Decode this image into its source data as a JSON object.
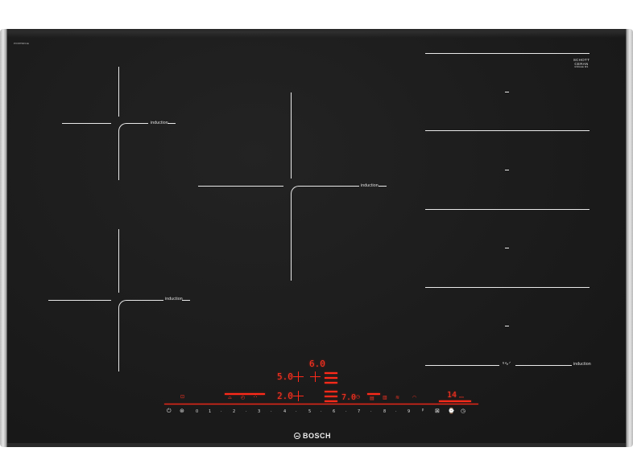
{
  "hob": {
    "model_code": "PXV875DV1E",
    "brand": "BOSCH",
    "glass_brand_line1": "SCHOTT",
    "glass_brand_line2": "CERAN",
    "glass_brand_line3": "MIRAGE MS",
    "zones": {
      "front_left_label": "induction",
      "rear_left_label": "induction",
      "center_label": "induction",
      "flex_label": "induction",
      "flex_link_icon": "link-wave-icon"
    }
  },
  "display": {
    "top_value": "6.0",
    "left_value": "5.0",
    "mid_value": "2.0",
    "right_value": "7.0",
    "timer_value": "14",
    "timer_unit": "min"
  },
  "scale": [
    "0",
    "1",
    "·",
    "2",
    "·",
    "3",
    "·",
    "4",
    "·",
    "5",
    "·",
    "6",
    "·",
    "7",
    "·",
    "8",
    "·",
    "9"
  ],
  "colors": {
    "glass": "#1b1b1b",
    "zone_lines": "#e9e9e9",
    "display_red": "#ff2a1a"
  }
}
